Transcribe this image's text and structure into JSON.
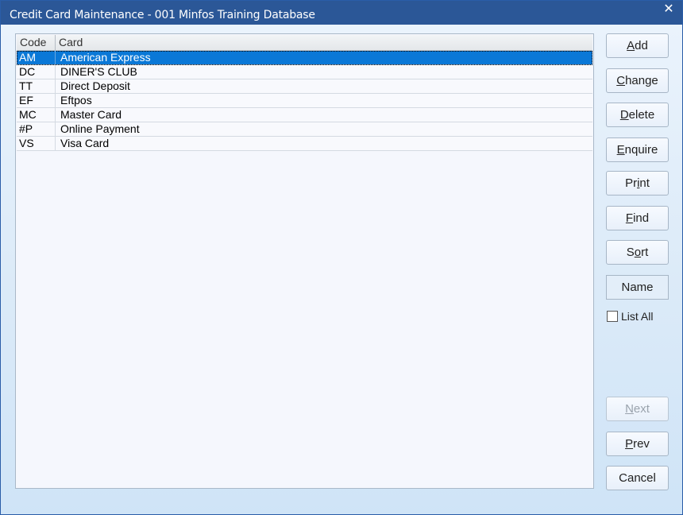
{
  "window": {
    "title": "Credit Card Maintenance - 001 Minfos Training Database",
    "close_glyph": "✕"
  },
  "grid": {
    "columns": [
      "Code",
      "Card"
    ],
    "rows": [
      {
        "code": "AM",
        "card": "American Express",
        "selected": true
      },
      {
        "code": "DC",
        "card": "DINER'S CLUB"
      },
      {
        "code": "TT",
        "card": "Direct Deposit"
      },
      {
        "code": "EF",
        "card": "Eftpos"
      },
      {
        "code": "MC",
        "card": "Master Card"
      },
      {
        "code": "#P",
        "card": "Online Payment"
      },
      {
        "code": "VS",
        "card": "Visa Card"
      }
    ]
  },
  "buttons": {
    "add": {
      "pre": "",
      "key": "A",
      "post": "dd"
    },
    "change": {
      "pre": "",
      "key": "C",
      "post": "hange"
    },
    "delete": {
      "pre": "",
      "key": "D",
      "post": "elete"
    },
    "enquire": {
      "pre": "",
      "key": "E",
      "post": "nquire"
    },
    "print": {
      "pre": "Pr",
      "key": "i",
      "post": "nt"
    },
    "find": {
      "pre": "",
      "key": "F",
      "post": "ind"
    },
    "sort": {
      "pre": "S",
      "key": "o",
      "post": "rt"
    },
    "name": "Name",
    "next": {
      "pre": "",
      "key": "N",
      "post": "ext"
    },
    "prev": {
      "pre": "",
      "key": "P",
      "post": "rev"
    },
    "cancel": "Cancel"
  },
  "list_all": {
    "label": "List All",
    "checked": false
  },
  "colors": {
    "titlebar": "#2b5797",
    "selection": "#0a78d7"
  }
}
